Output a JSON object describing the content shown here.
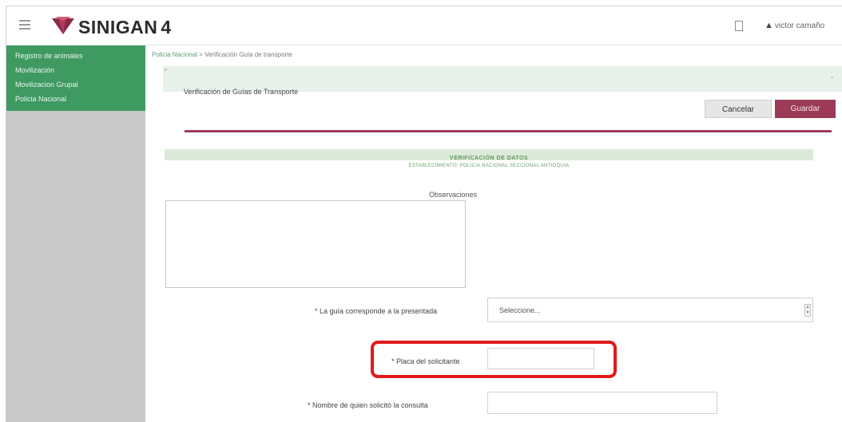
{
  "header": {
    "app_name": "SINIGAN",
    "version": "4",
    "user_name": "victor camaño",
    "icons": [
      "menu-icon",
      "sinigan-logo-icon",
      "document-icon",
      "user-icon"
    ]
  },
  "sidebar": {
    "items": [
      {
        "label": "Registro de animales"
      },
      {
        "label": "Movilización"
      },
      {
        "label": "Movilizacion Grupal"
      },
      {
        "label": "Policia Nacional"
      }
    ]
  },
  "breadcrumb": {
    "root": "Policia Nacional",
    "separator": ">",
    "current": "Verificación Guía de transporte"
  },
  "section": {
    "star": "*",
    "title": "Verificación de Guías de Transporte"
  },
  "actions": {
    "cancel": "Cancelar",
    "save": "Guardar"
  },
  "verification": {
    "title": "VERIFICACIÓN DE DATOS",
    "subtitle": "ESTABLECIMIENTO: POLICIA NACIONAL SECCIONAL ANTIOQUIA"
  },
  "form": {
    "observations_label": "Observaciones",
    "guide_label": "* La guía corresponde a la presentada",
    "guide_select_value": "Seleccione...",
    "plate_label": "* Placa del solicitante",
    "plate_value": "",
    "requester_label": "* Nombre de quien solicitó la consulta",
    "requester_value": ""
  },
  "colors": {
    "accent_green": "#3f9a62",
    "save_button": "#9b3b57",
    "highlight_box": "#e01b1b"
  }
}
